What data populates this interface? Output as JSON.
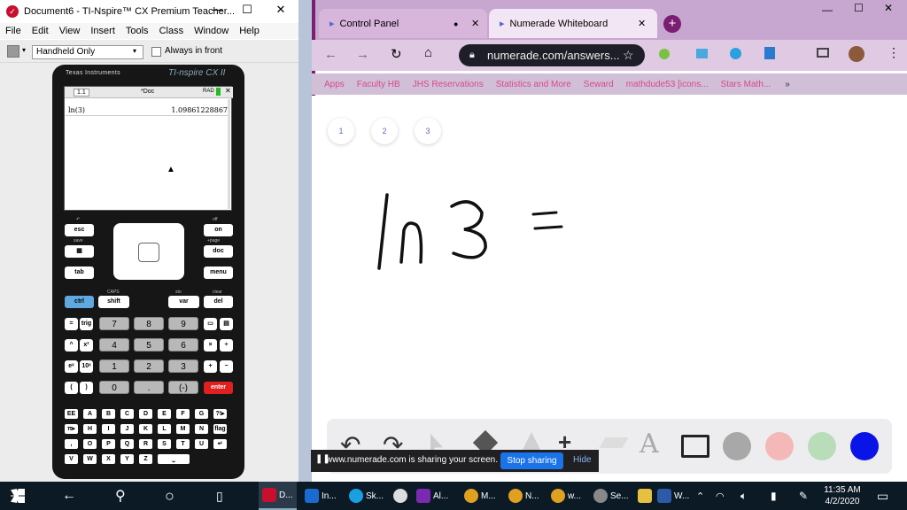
{
  "ti_window": {
    "title": "Document6 - TI-Nspire™ CX Premium Teacher...",
    "menu": [
      "File",
      "Edit",
      "View",
      "Insert",
      "Tools",
      "Class",
      "Window",
      "Help"
    ],
    "mode_select": "Handheld Only",
    "always_in_front": "Always in front"
  },
  "handheld": {
    "brand": "Texas Instruments",
    "model": "TI-nspire CX II",
    "tab": "1.1",
    "doc": "*Doc",
    "rad": "RAD",
    "expr": "ln(3)",
    "result": "1.09861228867",
    "keys": {
      "esc": "esc",
      "on": "on",
      "save": "save",
      "doc": "doc",
      "tab": "tab",
      "menu": "menu",
      "ctrl": "ctrl",
      "shift": "shift",
      "var": "var",
      "del": "del",
      "trig": "trig",
      "enter": "enter",
      "caps": "CAPS",
      "sto": "sto",
      "clear": "clear",
      "home_small": "+page",
      "off": "off"
    },
    "digits": [
      "7",
      "8",
      "9",
      "4",
      "5",
      "6",
      "1",
      "2",
      "3",
      "0",
      ".",
      "(-)"
    ],
    "alpha": [
      [
        "EE",
        "A",
        "B",
        "C",
        "D",
        "E",
        "F",
        "G",
        "?!▸"
      ],
      [
        "π▸",
        "H",
        "I",
        "J",
        "K",
        "L",
        "M",
        "N",
        "flag"
      ],
      [
        ",",
        "O",
        "P",
        "Q",
        "R",
        "S",
        "T",
        "U",
        "↵"
      ],
      [
        "V",
        "W",
        "X",
        "Y",
        "Z",
        "⎵"
      ]
    ]
  },
  "browser": {
    "tabs": [
      {
        "label": "Control Panel"
      },
      {
        "label": "Numerade Whiteboard"
      }
    ],
    "url": "numerade.com/answers...",
    "bookmarks": [
      "Apps",
      "Faculty HB",
      "JHS Reservations",
      "Statistics and More",
      "Seward",
      "mathdude53 [icons...",
      "Stars Math..."
    ],
    "pages": [
      "1",
      "2",
      "3"
    ],
    "share_text": "www.numerade.com is sharing your screen.",
    "stop_sharing": "Stop sharing",
    "hide": "Hide"
  },
  "taskbar": {
    "items": [
      "D...",
      "In...",
      "Sk...",
      "",
      "Al...",
      "M...",
      "N...",
      "w...",
      "Se...",
      "",
      "W..."
    ],
    "time": "11:35 AM",
    "date": "4/2/2020"
  },
  "colors": {
    "palette": [
      "#a8a8a8",
      "#f4b8b8",
      "#b8ddb8",
      "#0a14e6"
    ]
  }
}
